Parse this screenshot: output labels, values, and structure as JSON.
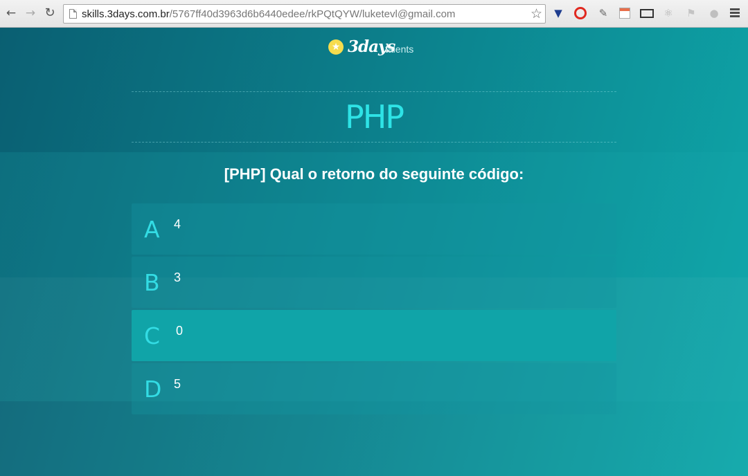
{
  "browser": {
    "url_host": "skills.3days.com.br",
    "url_path": "/5767ff40d3963d6b6440edee/rkPQtQYW/luketevl@gmail.com",
    "icons": [
      "back-icon",
      "forward-icon",
      "reload-icon",
      "page-icon",
      "bookmark-star-icon",
      "extension-icons",
      "menu-icon"
    ]
  },
  "logo": {
    "word": "3days",
    "sub": "talents"
  },
  "quiz": {
    "topic": "PHP",
    "question": "[PHP] Qual o retorno do seguinte código:",
    "options": [
      {
        "letter": "A",
        "text": "4"
      },
      {
        "letter": "B",
        "text": "3"
      },
      {
        "letter": "C",
        "text": "0",
        "selected": true
      },
      {
        "letter": "D",
        "text": "5"
      }
    ]
  },
  "colors": {
    "accent": "#2ee3e6",
    "selected_option": "#10a4a8",
    "background_dark": "#0a5f72",
    "background_light": "#0ea8aa"
  }
}
